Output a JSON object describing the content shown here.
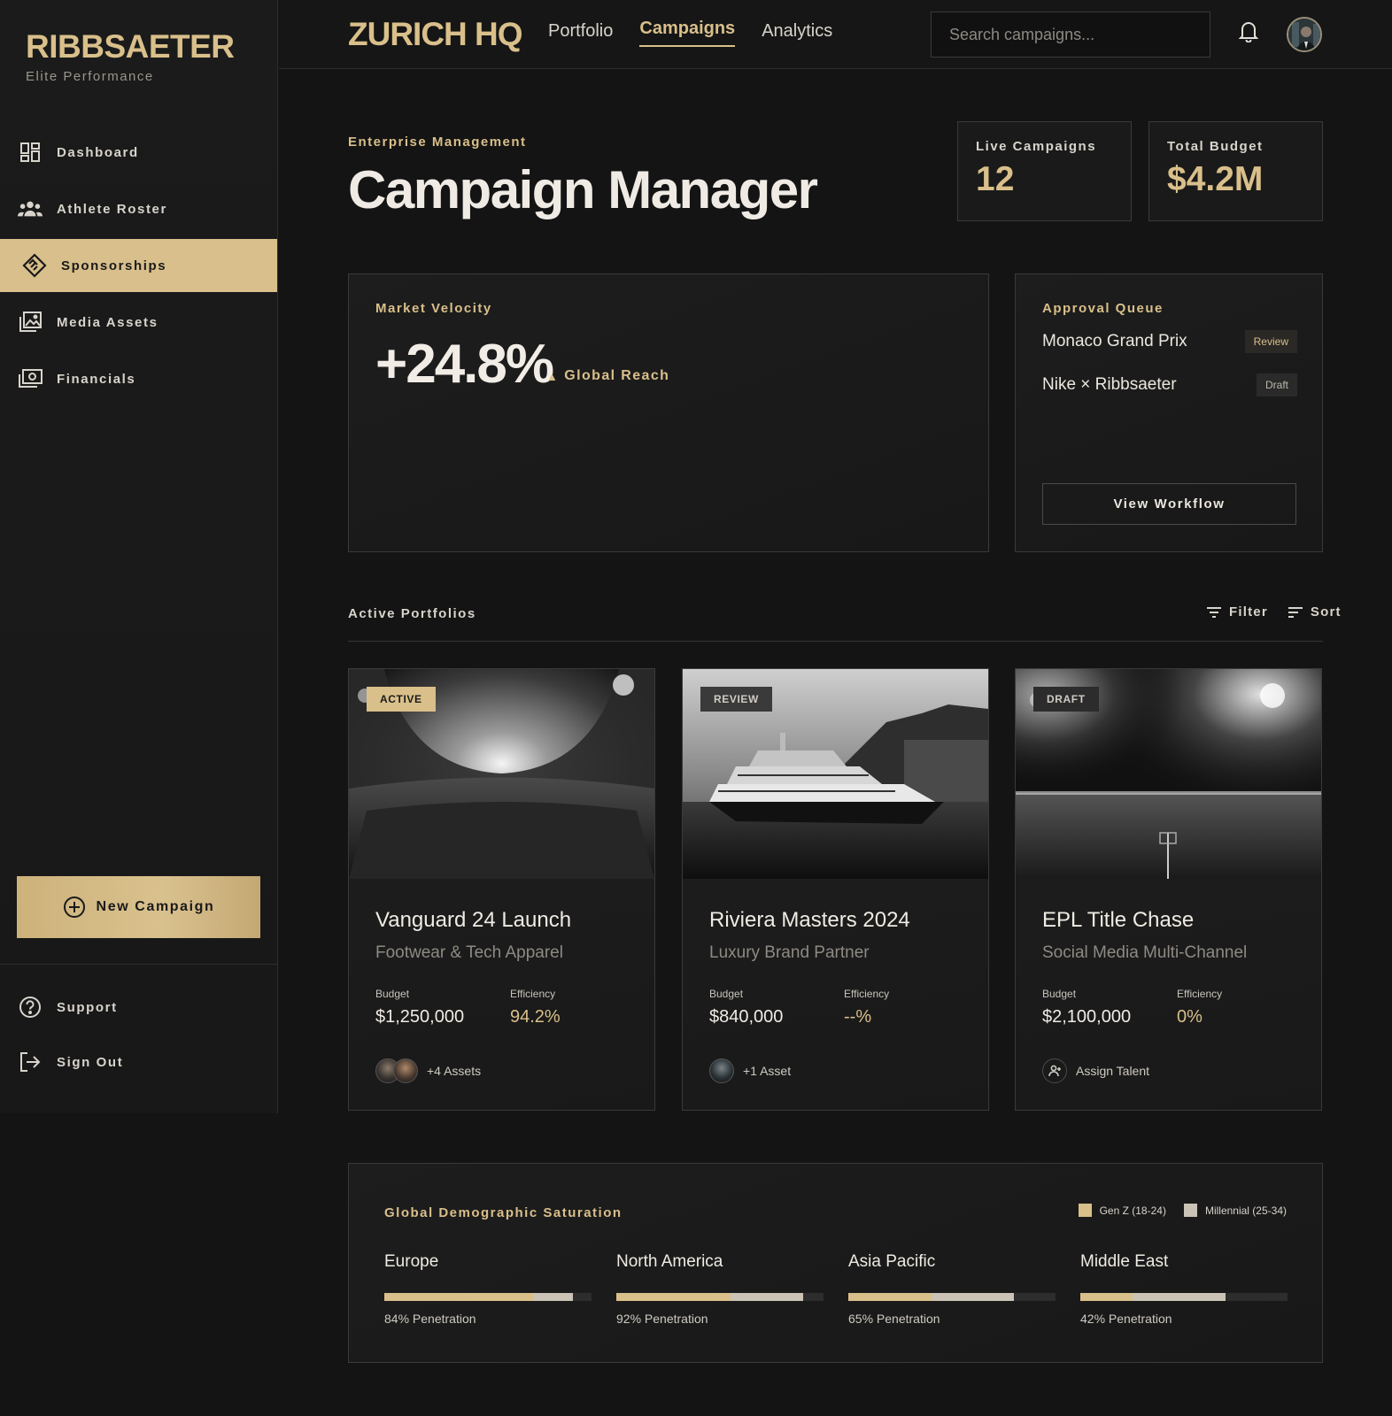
{
  "sidebar": {
    "brand": "RIBBSAETER",
    "brand_sub": "Elite Performance",
    "items": [
      {
        "label": "Dashboard",
        "icon": "dashboard-icon"
      },
      {
        "label": "Athlete Roster",
        "icon": "group-icon"
      },
      {
        "label": "Sponsorships",
        "icon": "handshake-icon",
        "active": true
      },
      {
        "label": "Media Assets",
        "icon": "photo-library-icon"
      },
      {
        "label": "Financials",
        "icon": "payments-icon"
      }
    ],
    "new_campaign": "New Campaign",
    "support": "Support",
    "sign_out": "Sign Out"
  },
  "topbar": {
    "title": "ZURICH HQ",
    "links": [
      "Portfolio",
      "Campaigns",
      "Analytics"
    ],
    "active_link": "Campaigns",
    "search_placeholder": "Search campaigns..."
  },
  "header": {
    "eyebrow": "Enterprise Management",
    "title": "Campaign Manager",
    "stats": [
      {
        "label": "Live Campaigns",
        "value": "12"
      },
      {
        "label": "Total Budget",
        "value": "$4.2M"
      }
    ]
  },
  "market_velocity": {
    "label": "Market Velocity",
    "value": "+24.8%",
    "delta": "Global Reach"
  },
  "approval_queue": {
    "label": "Approval Queue",
    "items": [
      {
        "name": "Monaco Grand Prix",
        "status": "Review"
      },
      {
        "name": "Nike × Ribbsaeter",
        "status": "Draft"
      }
    ],
    "button": "View Workflow"
  },
  "portfolios": {
    "title": "Active Portfolios",
    "filter": "Filter",
    "sort": "Sort",
    "cards": [
      {
        "badge": "ACTIVE",
        "title": "Vanguard 24 Launch",
        "subtitle": "Footwear & Tech Apparel",
        "budget_label": "Budget",
        "budget": "$1,250,000",
        "eff_label": "Efficiency",
        "efficiency": "94.2%",
        "assets": "+4 Assets"
      },
      {
        "badge": "REVIEW",
        "title": "Riviera Masters 2024",
        "subtitle": "Luxury Brand Partner",
        "budget_label": "Budget",
        "budget": "$840,000",
        "eff_label": "Efficiency",
        "efficiency": "--%",
        "assets": "+1 Asset"
      },
      {
        "badge": "DRAFT",
        "title": "EPL Title Chase",
        "subtitle": "Social Media Multi-Channel",
        "budget_label": "Budget",
        "budget": "$2,100,000",
        "eff_label": "Efficiency",
        "efficiency": "0%",
        "assets": "Assign Talent"
      }
    ]
  },
  "demographics": {
    "title": "Global Demographic Saturation",
    "legend": [
      {
        "name": "Gen Z (18-24)",
        "color": "#d9bf8a"
      },
      {
        "name": "Millennial (25-34)",
        "color": "#cbc4b6"
      }
    ],
    "regions": [
      {
        "name": "Europe",
        "penetration_label": "84% Penetration",
        "genz": 0.72,
        "millennial": 0.91
      },
      {
        "name": "North America",
        "penetration_label": "92% Penetration",
        "genz": 0.55,
        "millennial": 0.9
      },
      {
        "name": "Asia Pacific",
        "penetration_label": "65% Penetration",
        "genz": 0.4,
        "millennial": 0.8
      },
      {
        "name": "Middle East",
        "penetration_label": "42% Penetration",
        "genz": 0.25,
        "millennial": 0.7
      }
    ]
  },
  "colors": {
    "accent": "#d9bf8a",
    "background": "#141414",
    "panel": "#1b1b1b",
    "border": "#3a3a3a"
  }
}
